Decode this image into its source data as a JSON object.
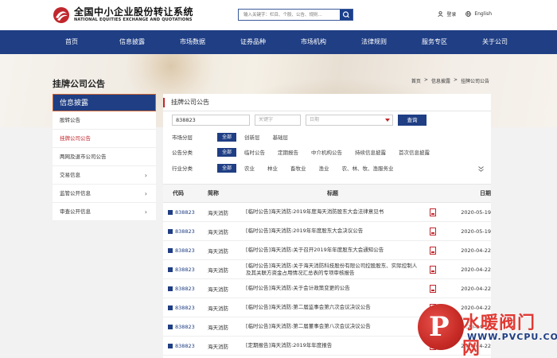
{
  "header": {
    "logo_cn": "全国中小企业股份转让系统",
    "logo_en": "NATIONAL EQUITIES EXCHANGE AND QUOTATIONS",
    "search_placeholder": "输入关键字：栏目、个股、公告、规则...",
    "login": "登录",
    "language": "English"
  },
  "nav": [
    "首页",
    "信息披露",
    "市场数据",
    "证券品种",
    "市场机构",
    "法律规则",
    "服务专区",
    "关于公司"
  ],
  "page": {
    "title": "挂牌公司公告",
    "breadcrumb": [
      "首页",
      ">",
      "信息披露",
      ">",
      "挂牌公司公告"
    ]
  },
  "sidebar": {
    "title": "信息披露",
    "items": [
      {
        "label": "股转公告",
        "chevron": false,
        "active": false
      },
      {
        "label": "挂牌公司公告",
        "chevron": false,
        "active": true
      },
      {
        "label": "两网及退市公司公告",
        "chevron": false,
        "active": false
      },
      {
        "label": "交易信息",
        "chevron": true,
        "active": false
      },
      {
        "label": "监管公开信息",
        "chevron": true,
        "active": false
      },
      {
        "label": "审查公开信息",
        "chevron": true,
        "active": false
      }
    ]
  },
  "main": {
    "title": "挂牌公司公告",
    "code_value": "838823",
    "keyword_placeholder": "关键字",
    "date_placeholder": "日期",
    "query_label": "查询",
    "filters": [
      {
        "label": "市场分层",
        "all": "全部",
        "options": [
          "创新层",
          "基础层"
        ]
      },
      {
        "label": "公告分类",
        "all": "全部",
        "options": [
          "临时公告",
          "定期报告",
          "中介机构公告",
          "持续信息披露",
          "首次信息披露"
        ]
      },
      {
        "label": "行业分类",
        "all": "全部",
        "options": [
          "农业",
          "林业",
          "畜牧业",
          "渔业",
          "农、林、牧、渔服务业"
        ]
      }
    ],
    "expand_icon": "chevron-double-down"
  },
  "table": {
    "headers": {
      "code": "代码",
      "name": "简称",
      "title": "标题",
      "date": "日期"
    },
    "rows": [
      {
        "code": "838823",
        "name": "海天消防",
        "title": "[临时公告]海天消防:2019年度海天消防股东大会法律意见书",
        "date": "2020-05-19"
      },
      {
        "code": "838823",
        "name": "海天消防",
        "title": "[临时公告]海天消防:2019年年度股东大会决议公告",
        "date": "2020-05-19"
      },
      {
        "code": "838823",
        "name": "海天消防",
        "title": "[临时公告]海天消防:关于召开2019年年度股东大会通知公告",
        "date": "2020-04-22"
      },
      {
        "code": "838823",
        "name": "海天消防",
        "title": "[临时公告]海天消防:关于海天消防科技股份有限公司控股股东、实际控制人及其关联方资金占用情况汇总表的专项审核报告",
        "date": "2020-04-22"
      },
      {
        "code": "838823",
        "name": "海天消防",
        "title": "[临时公告]海天消防:关于会计政策变更的公告",
        "date": "2020-04-22"
      },
      {
        "code": "838823",
        "name": "海天消防",
        "title": "[临时公告]海天消防:第二届监事会第六次会议决议公告",
        "date": "2020-04-22"
      },
      {
        "code": "838823",
        "name": "海天消防",
        "title": "[临时公告]海天消防:第二届董事会第八次会议决议公告",
        "date": "2020-04-22"
      },
      {
        "code": "838823",
        "name": "海天消防",
        "title": "[定期报告]海天消防:2019年年度报告",
        "date": "2020-04-22"
      }
    ]
  },
  "watermark": {
    "letter": "P",
    "cn": "水暖阀门网",
    "en": "WWW.PVCPU.COM"
  },
  "colors": {
    "navy": "#1f3e84",
    "accent_red": "#c0272d"
  }
}
